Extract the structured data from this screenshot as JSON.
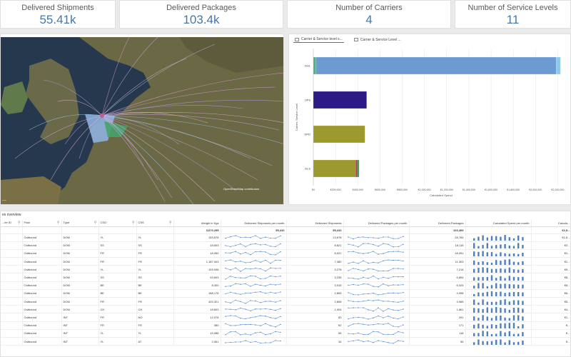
{
  "kpis": [
    {
      "title": "Delivered Shipments",
      "value": "55.41k"
    },
    {
      "title": "Delivered Packages",
      "value": "103.4k"
    },
    {
      "title": "Number of Carriers",
      "value": "4"
    },
    {
      "title": "Number of Service Levels",
      "value": "11"
    }
  ],
  "map": {
    "attribution": "OpenStreetMap contributors"
  },
  "chart_tabs": [
    "Carrier & Service level s...",
    "Carrier & Service Level ..."
  ],
  "chart_data": {
    "type": "bar",
    "orientation": "horizontal",
    "stacked": true,
    "categories": [
      "DHL",
      "UPS",
      "DPD",
      "GLS"
    ],
    "xlabel": "Calculated Spend",
    "ylabel": "Carrier, Service Level",
    "xlim": [
      0,
      2300000
    ],
    "xticks": [
      "€0",
      "€200,000",
      "€400,000",
      "€600,000",
      "€800,000",
      "€1,000,000",
      "€1,200,000",
      "€1,400,000",
      "€1,600,000",
      "€1,800,000",
      "€2,000,000",
      "€2,200,000"
    ],
    "series": [
      {
        "color": "#4fae8a",
        "values": [
          25000,
          0,
          0,
          0
        ]
      },
      {
        "color": "#6b9bd1",
        "values": [
          2160000,
          0,
          0,
          0
        ]
      },
      {
        "color": "#8ecae6",
        "values": [
          40000,
          0,
          0,
          0
        ]
      },
      {
        "color": "#2e1a87",
        "values": [
          0,
          480000,
          0,
          0
        ]
      },
      {
        "color": "#9c9a2e",
        "values": [
          0,
          0,
          465000,
          380000
        ]
      },
      {
        "color": "#c0392b",
        "values": [
          0,
          0,
          0,
          15000
        ]
      },
      {
        "color": "#1e8a3c",
        "values": [
          0,
          0,
          0,
          15000
        ]
      }
    ]
  },
  "table": {
    "title": "es overview",
    "headers": [
      "...ier ID",
      "Flow",
      "Type",
      "CSO",
      "CSS",
      "Weight in Kgs",
      "Delivered Shipments per month",
      "Delivered Shipments",
      "Delivered Packages per month",
      "Delivered Packages",
      "Calculated Spend per month",
      "Calcula..."
    ],
    "totals": [
      "",
      "",
      "",
      "",
      "",
      "3,670,255",
      "55,410",
      "55,410",
      "",
      "103,409",
      "",
      "€2,5..."
    ],
    "rows": [
      [
        "",
        "Outbound",
        "DOM",
        "YL",
        "YL",
        "153,678",
        "",
        "13,678",
        "",
        "28,784",
        "",
        "€1,6..."
      ],
      [
        "",
        "Outbound",
        "DOM",
        "SS",
        "SS",
        "18,603",
        "",
        "8,821",
        "",
        "18,116",
        "",
        "€2..."
      ],
      [
        "",
        "Outbound",
        "DOM",
        "FR",
        "FR",
        "18,060",
        "",
        "8,022",
        "",
        "18,051",
        "",
        "€1..."
      ],
      [
        "",
        "Outbound",
        "DOM",
        "FR",
        "FR",
        "1,187,003",
        "",
        "7,380",
        "",
        "11,303",
        "",
        "€1..."
      ],
      [
        "",
        "Outbound",
        "DOM",
        "YL",
        "YL",
        "153,938",
        "",
        "3,278",
        "",
        "7,216",
        "",
        "€9..."
      ],
      [
        "",
        "Outbound",
        "DOM",
        "SS",
        "SS",
        "53,603",
        "",
        "3,235",
        "",
        "6,854",
        "",
        "€8..."
      ],
      [
        "",
        "Outbound",
        "DOM",
        "BE",
        "BE",
        "8,300",
        "",
        "3,015",
        "",
        "6,024",
        "",
        "€8..."
      ],
      [
        "",
        "Outbound",
        "DOM",
        "BE",
        "BE",
        "188,178",
        "",
        "2,805",
        "",
        "4,998",
        "",
        "€6..."
      ],
      [
        "",
        "Outbound",
        "DOM",
        "FR",
        "FR",
        "403,321",
        "",
        "2,808",
        "",
        "3,965",
        "",
        "€5..."
      ],
      [
        "",
        "Outbound",
        "DOM",
        "CH",
        "CH",
        "18,603",
        "",
        "1,004",
        "",
        "1,861",
        "",
        "€4..."
      ],
      [
        "",
        "Outbound",
        "INT",
        "FR",
        "NO",
        "12,078",
        "",
        "83",
        "",
        "291",
        "",
        "€1..."
      ],
      [
        "",
        "Outbound",
        "INT",
        "FR",
        "FR",
        "380",
        "",
        "62",
        "",
        "171",
        "",
        "€..."
      ],
      [
        "",
        "Outbound",
        "INT",
        "YL",
        "YL",
        "15,088",
        "",
        "56",
        "",
        "118",
        "",
        "€..."
      ],
      [
        "",
        "Outbound",
        "INT",
        "YL",
        "AT",
        "2,061",
        "",
        "34",
        "",
        "56",
        "",
        "€..."
      ]
    ]
  }
}
